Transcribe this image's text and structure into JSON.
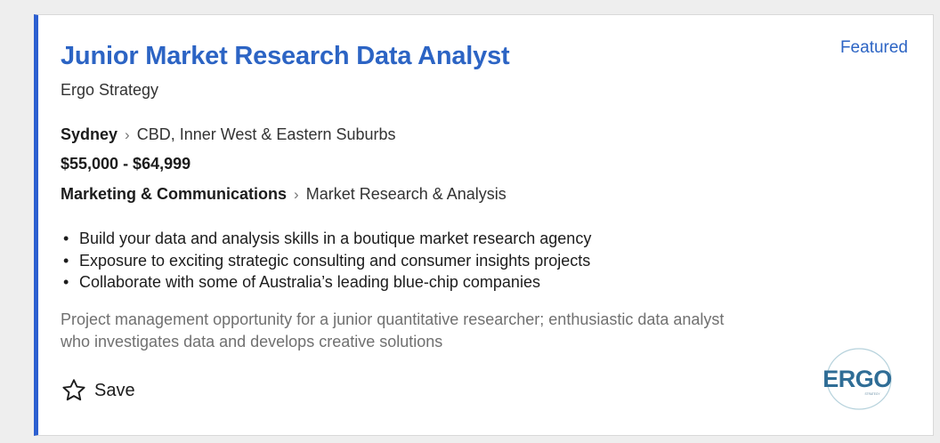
{
  "job": {
    "title": "Junior Market Research Data Analyst",
    "company": "Ergo Strategy",
    "badge": "Featured",
    "location": {
      "city": "Sydney",
      "area": "CBD, Inner West & Eastern Suburbs"
    },
    "salary": "$55,000 - $64,999",
    "classification": {
      "category": "Marketing & Communications",
      "subcategory": "Market Research & Analysis"
    },
    "bullets": [
      "Build your data and analysis skills in a boutique market research agency",
      "Exposure to exciting strategic consulting and consumer insights projects",
      "Collaborate with some of Australia’s leading blue-chip companies"
    ],
    "teaser": "Project management opportunity for a junior quantitative researcher; enthusiastic data analyst who investigates data and develops creative solutions",
    "save_label": "Save",
    "logo": {
      "wordmark": "ERGO",
      "tagline": "STRATEGY"
    }
  },
  "colors": {
    "accent": "#2c5fd0",
    "title": "#2c64c4",
    "teaser": "#707070"
  },
  "icons": {
    "save": "star-outline-icon",
    "separator": "chevron-right-icon"
  }
}
